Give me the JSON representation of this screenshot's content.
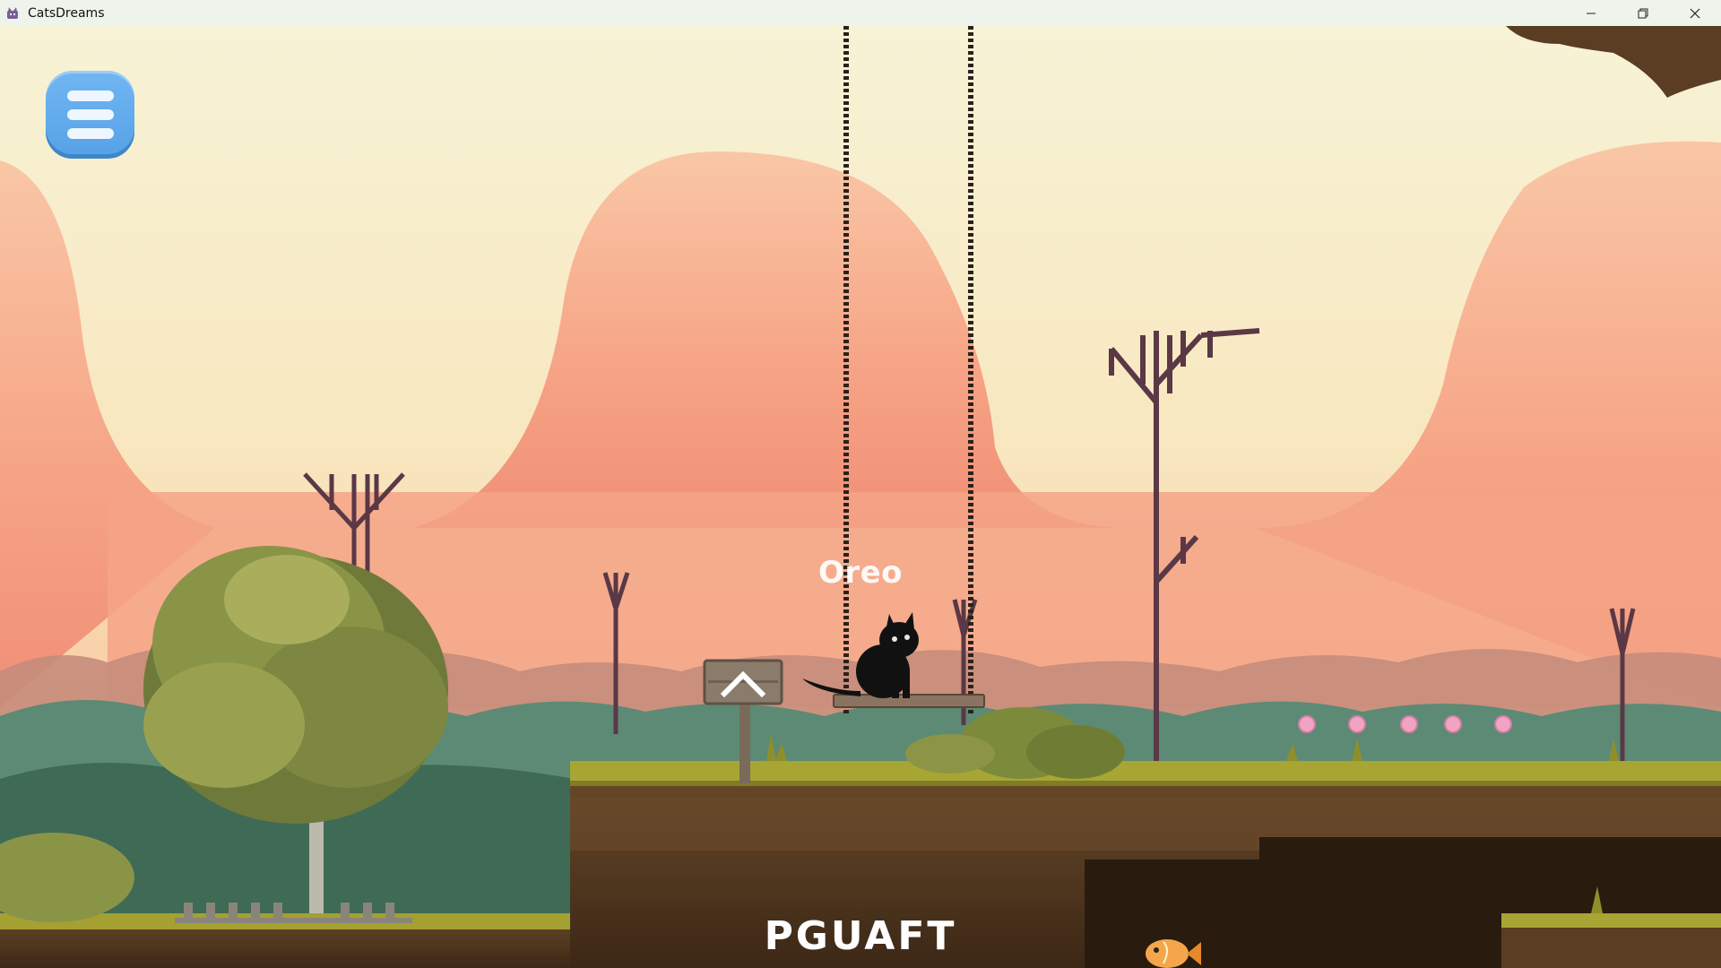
{
  "window": {
    "title": "CatsDreams",
    "controls": [
      "minimize-icon",
      "restore-icon",
      "close-icon"
    ]
  },
  "hud": {
    "menu_icon": "hamburger-menu-icon"
  },
  "player": {
    "name": "Oreo"
  },
  "code_display": {
    "text": "PGUAFT"
  },
  "signpost": {
    "icon": "chevron-up-icon"
  },
  "collectibles": {
    "pink_orbs": 5,
    "fish": 1
  },
  "colors": {
    "sky_top": "#f6f1d2",
    "sky_bottom": "#f8c7a0",
    "hills": "#f6a585",
    "grass": "#a7a534",
    "dirt": "#5a3d22",
    "menu_button": "#5aa5e8",
    "orb": "#f0a3c2"
  }
}
